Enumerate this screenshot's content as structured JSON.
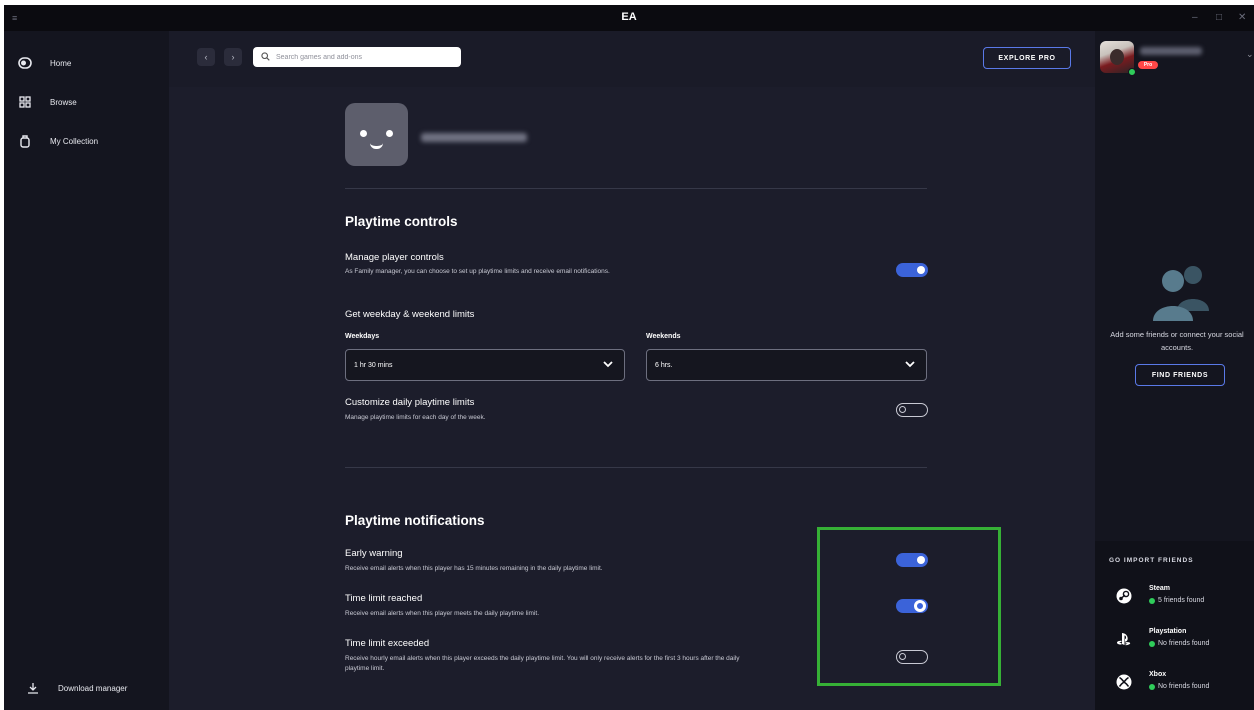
{
  "window": {
    "title": "EA"
  },
  "sidebar": {
    "items": [
      {
        "label": "Home",
        "icon": "home-icon"
      },
      {
        "label": "Browse",
        "icon": "browse-icon"
      },
      {
        "label": "My Collection",
        "icon": "collection-icon"
      }
    ],
    "download_label": "Download manager"
  },
  "topbar": {
    "search_placeholder": "Search games and add-ons",
    "explore_label": "EXPLORE PRO"
  },
  "profile": {
    "badge": "Pro"
  },
  "friends": {
    "empty_text": "Add some friends or connect your social accounts.",
    "find_label": "FIND FRIENDS",
    "import_title": "GO IMPORT FRIENDS",
    "platforms": [
      {
        "name": "Steam",
        "status": "5 friends found",
        "icon": "steam-icon"
      },
      {
        "name": "Playstation",
        "status": "No friends found",
        "icon": "playstation-icon"
      },
      {
        "name": "Xbox",
        "status": "No friends found",
        "icon": "xbox-icon"
      }
    ]
  },
  "playtime_controls": {
    "title": "Playtime controls",
    "manage": {
      "title": "Manage player controls",
      "desc": "As Family manager, you can choose to set up playtime limits and receive email notifications.",
      "enabled": true
    },
    "limits_title": "Get weekday & weekend limits",
    "weekdays": {
      "label": "Weekdays",
      "value": "1 hr 30 mins"
    },
    "weekends": {
      "label": "Weekends",
      "value": "6 hrs."
    },
    "customize": {
      "title": "Customize daily playtime limits",
      "desc": "Manage playtime limits for each day of the week.",
      "enabled": false
    }
  },
  "playtime_notifications": {
    "title": "Playtime notifications",
    "items": [
      {
        "title": "Early warning",
        "desc": "Receive email alerts when this player has 15 minutes remaining in the daily playtime limit.",
        "enabled": true
      },
      {
        "title": "Time limit reached",
        "desc": "Receive email alerts when this player meets the daily playtime limit.",
        "enabled": true
      },
      {
        "title": "Time limit exceeded",
        "desc": "Receive hourly email alerts when this player exceeds the daily playtime limit. You will only receive alerts for the first 3 hours after the daily playtime limit.",
        "enabled": false
      }
    ]
  },
  "colors": {
    "accent": "#3b63d9",
    "highlight": "#36b036",
    "online": "#2fcc5a",
    "pro": "#ff4747"
  }
}
